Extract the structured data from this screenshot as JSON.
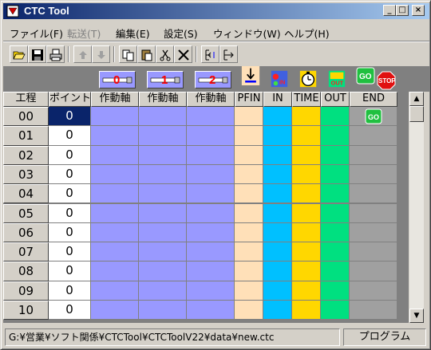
{
  "window": {
    "title": "CTC Tool"
  },
  "menu": [
    "ファイル(F)",
    "転送(T)",
    "編集(E)",
    "設定(S)",
    "ウィンドウ(W)",
    "ヘルプ(H)"
  ],
  "command_icons": {
    "in": "IN",
    "out": "OUT",
    "go": "GO",
    "stop": "STOP"
  },
  "axis_buttons": [
    "0",
    "1",
    "2"
  ],
  "grid": {
    "headers": [
      "工程",
      "ポイント",
      "作動軸",
      "作動軸",
      "作動軸",
      "PFIN",
      "IN",
      "TIME",
      "OUT",
      "END"
    ],
    "rows": [
      {
        "step": "00",
        "point": "0"
      },
      {
        "step": "01",
        "point": "0"
      },
      {
        "step": "02",
        "point": "0"
      },
      {
        "step": "03",
        "point": "0"
      },
      {
        "step": "04",
        "point": "0"
      },
      {
        "step": "05",
        "point": "0"
      },
      {
        "step": "06",
        "point": "0"
      },
      {
        "step": "07",
        "point": "0"
      },
      {
        "step": "08",
        "point": "0"
      },
      {
        "step": "09",
        "point": "0"
      },
      {
        "step": "10",
        "point": "0"
      }
    ],
    "end_go_label": "GO"
  },
  "colors": {
    "axis": "#9999ff",
    "pfin": "#ffe0b8",
    "in": "#00c0ff",
    "time": "#ffd700",
    "out": "#00e080",
    "end": "#a0a0a0"
  },
  "status": {
    "path": "G:¥営業¥ソフト関係¥CTCTool¥CTCToolV22¥data¥new.ctc",
    "mode": "プログラム"
  }
}
